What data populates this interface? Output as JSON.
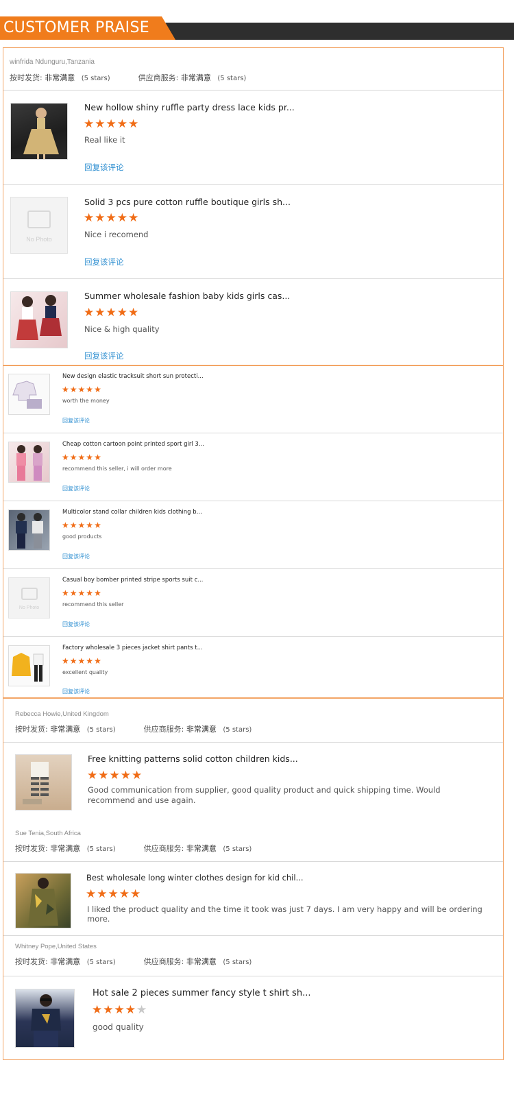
{
  "header": {
    "title": "CUSTOMER PRAISE"
  },
  "labels": {
    "ontime": "按时发货:",
    "service": "供应商服务:",
    "very_satisfied": "非常满意",
    "five_stars": "(5 stars)",
    "reply": "回复该评论",
    "no_photo": "No Photo"
  },
  "colors": {
    "accent": "#f07c1c",
    "star": "#f06c16",
    "link": "#2f8fd1",
    "banner_dark": "#2e2e2e"
  },
  "reviews": [
    {
      "reviewer": "winfrida Ndunguru,Tanzania",
      "products": [
        {
          "title": "New hollow shiny ruffle party dress lace kids pr...",
          "rating": 5,
          "comment": "Real like it",
          "image": "girl-dress-photo"
        },
        {
          "title": "Solid 3 pcs pure cotton ruffle boutique girls sh...",
          "rating": 5,
          "comment": "Nice i recomend",
          "image": "no-photo"
        },
        {
          "title": "Summer wholesale fashion baby kids girls cas...",
          "rating": 5,
          "comment": "Nice & high quality",
          "image": "girls-outfit-photo"
        }
      ],
      "more_products": [
        {
          "title": "New design elastic tracksuit short sun protecti...",
          "rating": 5,
          "comment": "worth the money",
          "image": "tracksuit-photo"
        },
        {
          "title": "Cheap cotton cartoon point printed sport girl 3...",
          "rating": 5,
          "comment": "recommend this seller, i will order more",
          "image": "pink-sport-photo"
        },
        {
          "title": "Multicolor stand collar children kids clothing b...",
          "rating": 5,
          "comment": "good products",
          "image": "boys-clothing-photo"
        },
        {
          "title": "Casual boy bomber printed stripe sports suit c...",
          "rating": 5,
          "comment": "recommend this seller",
          "image": "no-photo"
        },
        {
          "title": "Factory wholesale 3 pieces jacket shirt pants t...",
          "rating": 5,
          "comment": "excellent quality",
          "image": "yellow-jacket-photo"
        }
      ]
    },
    {
      "reviewer": "Rebecca Howie,United Kingdom",
      "products": [
        {
          "title": "Free knitting patterns solid cotton children kids...",
          "rating": 5,
          "comment": "Good communication from supplier, good quality product and quick shipping time. Would recommend and use again.",
          "image": "striped-pants-photo"
        }
      ]
    },
    {
      "reviewer": "Sue Tenia,South Africa",
      "products": [
        {
          "title": "Best wholesale long winter clothes design for kid chil...",
          "rating": 5,
          "comment": "I liked the product quality and the time it took was just 7 days. I am very happy and will be ordering more.",
          "image": "camo-coat-photo"
        }
      ]
    },
    {
      "reviewer": "Whitney Pope,United States",
      "products": [
        {
          "title": "Hot sale 2 pieces summer fancy style t shirt sh...",
          "rating": 4,
          "comment": "good quality",
          "image": "navy-tshirt-photo"
        }
      ]
    }
  ]
}
